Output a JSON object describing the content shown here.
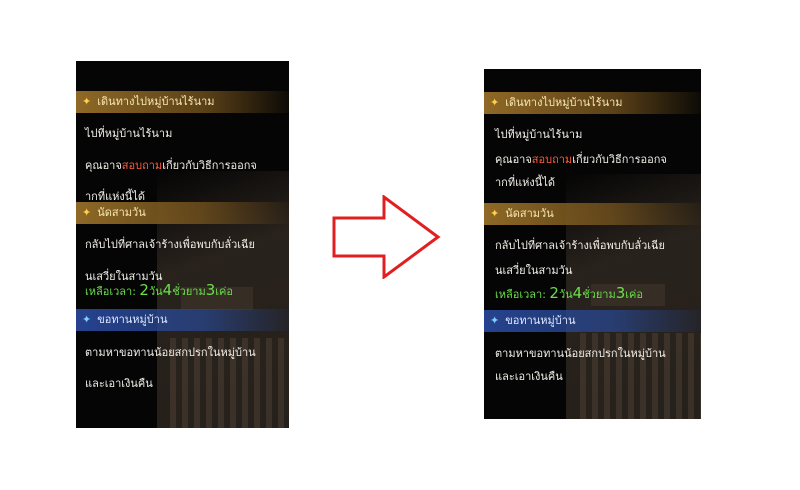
{
  "panels": [
    {
      "quests": [
        {
          "title": "เดินทางไปหมู่บ้านไร้นาม",
          "lines": [
            "ไปที่หมู่บ้านไร้นาม"
          ],
          "desc_pre": "คุณอาจ",
          "desc_hl": "สอบถาม",
          "desc_post": "เกี่ยวกับวิธีการออกจ",
          "desc_line2": "ากที่แห่งนี้ได้"
        },
        {
          "title": "นัดสามวัน",
          "line1": "กลับไปที่ศาลเจ้าร้างเพื่อพบกับลั่วเฉีย",
          "line2": "นเสวี่ยในสามวัน",
          "timer_label": "เหลือเวลา: ",
          "timer_n1": "2",
          "timer_u1": "วัน",
          "timer_n2": "4",
          "timer_u2": "ชั่วยาม",
          "timer_n3": "3",
          "timer_u3": "เค่อ"
        },
        {
          "title": "ขอทานหมู่บ้าน",
          "line1": "ตามหาขอทานน้อยสกปรกในหมู่บ้าน",
          "line2": "และเอาเงินคืน"
        }
      ]
    }
  ],
  "icons": {
    "gold_quest": "diamond-icon",
    "blue_quest": "diamond-icon",
    "arrow": "right-arrow-icon"
  },
  "colors": {
    "gold_header": "#96702a",
    "blue_header": "#28469a",
    "highlight_text": "#ff5a3a",
    "timer_text": "#6adf4a",
    "arrow_outline": "#e02020"
  }
}
